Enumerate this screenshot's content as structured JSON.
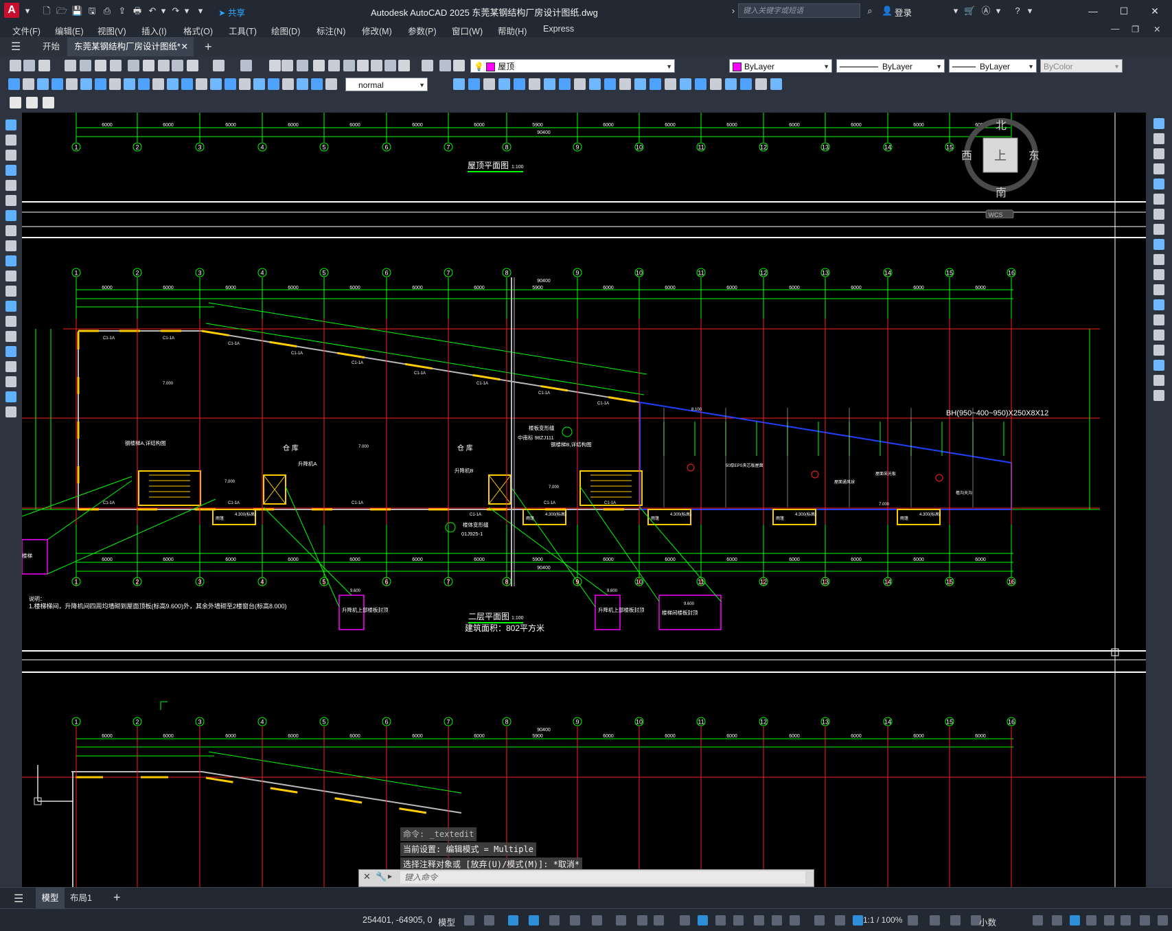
{
  "app": {
    "title": "Autodesk AutoCAD 2025    东莞某钢结构厂房设计图纸.dwg",
    "share_label": "共享",
    "search_placeholder": "键入关键字或短语",
    "login_label": "登录"
  },
  "menu": [
    "文件(F)",
    "编辑(E)",
    "视图(V)",
    "插入(I)",
    "格式(O)",
    "工具(T)",
    "绘图(D)",
    "标注(N)",
    "修改(M)",
    "参数(P)",
    "窗口(W)",
    "帮助(H)",
    "Express"
  ],
  "tabs": {
    "start": "开始",
    "active_doc": "东莞某钢结构厂房设计图纸*"
  },
  "properties": {
    "layer": "屋顶",
    "color": "ByLayer",
    "linetype": "ByLayer",
    "lineweight": "ByLayer",
    "plotstyle": "ByColor",
    "dimstyle": "normal"
  },
  "viewcube": {
    "north": "北",
    "south": "南",
    "east": "东",
    "west": "西",
    "top": "上",
    "wcs": "WCS"
  },
  "drawing": {
    "roof_plan_title": "屋顶平面图",
    "roof_plan_scale": "1:100",
    "second_floor_title": "二层平面图",
    "second_floor_scale": "1:100",
    "building_area": "建筑面积：802平方米",
    "notes_title": "说明：",
    "notes_line1": "1.楼梯梯间，升降机间四周均墙砌到屋面顶板(标高9.600)外，其余外墙砌至2楼窗台(标高8.000)",
    "beam_label": "BH(950~400~950)X250X8X12",
    "warehouse": "仓  库",
    "total_span": "90400",
    "span_6000": "6000",
    "span_5900": "5900",
    "axis_numbers": [
      "1",
      "2",
      "3",
      "4",
      "5",
      "6",
      "7",
      "8",
      "9",
      "10",
      "11",
      "12",
      "13",
      "14",
      "15",
      "16"
    ],
    "callouts": {
      "stair_a": "钢楼梯A,详结构图",
      "stair_b": "钢楼梯B,详结构图",
      "lift_a": "升降机A",
      "lift_b": "升降机B",
      "lift_slab": "升降机上部楼板封顶",
      "stair_slab": "楼梯间楼板封顶",
      "deform_joint": "楼板变形缝",
      "deform_joint2": "楼体变形缝",
      "sheet_ref": "中南标 98ZJ111",
      "sheet_ref2": "01J925-1",
      "level_7000": "7.000",
      "level_4300": "4.300(标高)",
      "level_9600": "9.600",
      "level_8100": "8.100",
      "window_c1": "C1-1A",
      "canopy": "雨篷",
      "eps": "50厚EPS夹芯板屋面",
      "roof_drain": "屋面通风球",
      "roof_light": "屋面采光板",
      "gutter": "檐沟天沟",
      "stair_short": "楼梯"
    }
  },
  "command": {
    "line1": "命令: _textedit",
    "line2": "当前设置: 编辑模式 = Multiple",
    "line3": "选择注释对象或 [放弃(U)/模式(M)]: *取消*",
    "input_placeholder": "键入命令"
  },
  "layout_tabs": [
    "模型",
    "布局1"
  ],
  "status": {
    "coords": "254401, -64905, 0",
    "model": "模型",
    "scale": "1:1 / 100%",
    "units": "小数"
  },
  "colors": {
    "grid": "#00ff00",
    "axis": "#ff2020",
    "window": "#ffcc00",
    "magenta": "#ff00ff",
    "blue": "#2040ff",
    "white": "#ffffff"
  }
}
